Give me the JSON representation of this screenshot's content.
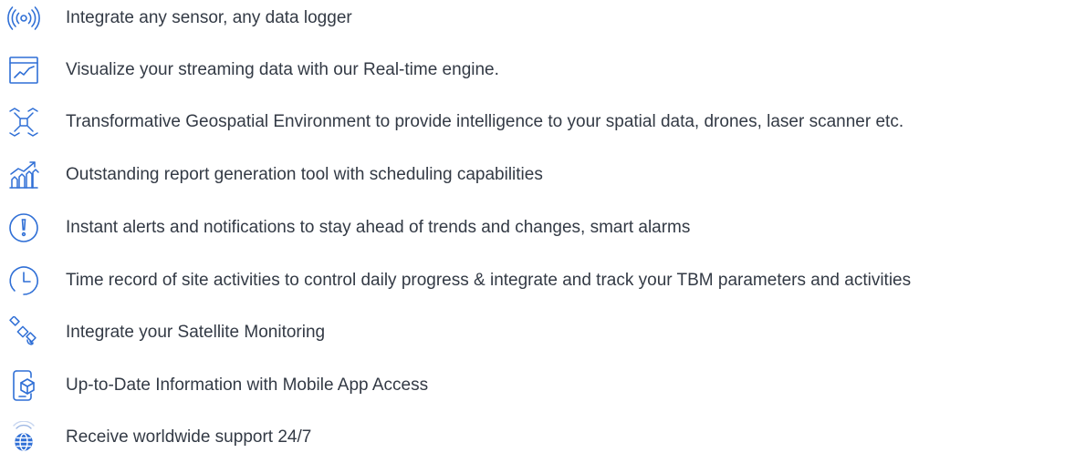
{
  "accent_color": "#2f6fd6",
  "text_color": "#333a45",
  "features": [
    {
      "icon": "sensor-signal-icon",
      "text": "Integrate any sensor, any data logger"
    },
    {
      "icon": "line-chart-icon",
      "text": "Visualize your streaming data with our Real-time engine."
    },
    {
      "icon": "drone-icon",
      "text": "Transformative Geospatial Environment to provide intelligence to your spatial data, drones, laser scanner etc."
    },
    {
      "icon": "report-chart-icon",
      "text": "Outstanding report generation tool with scheduling capabilities"
    },
    {
      "icon": "alert-icon",
      "text": "Instant alerts and notifications to stay ahead of trends and changes, smart alarms"
    },
    {
      "icon": "clock-icon",
      "text": "Time record of site activities to control daily progress & integrate and track your TBM parameters and activities"
    },
    {
      "icon": "satellite-icon",
      "text": "Integrate your Satellite Monitoring"
    },
    {
      "icon": "mobile-app-icon",
      "text": "Up-to-Date Information with Mobile App Access"
    },
    {
      "icon": "globe-support-icon",
      "text": "Receive worldwide support 24/7"
    }
  ]
}
